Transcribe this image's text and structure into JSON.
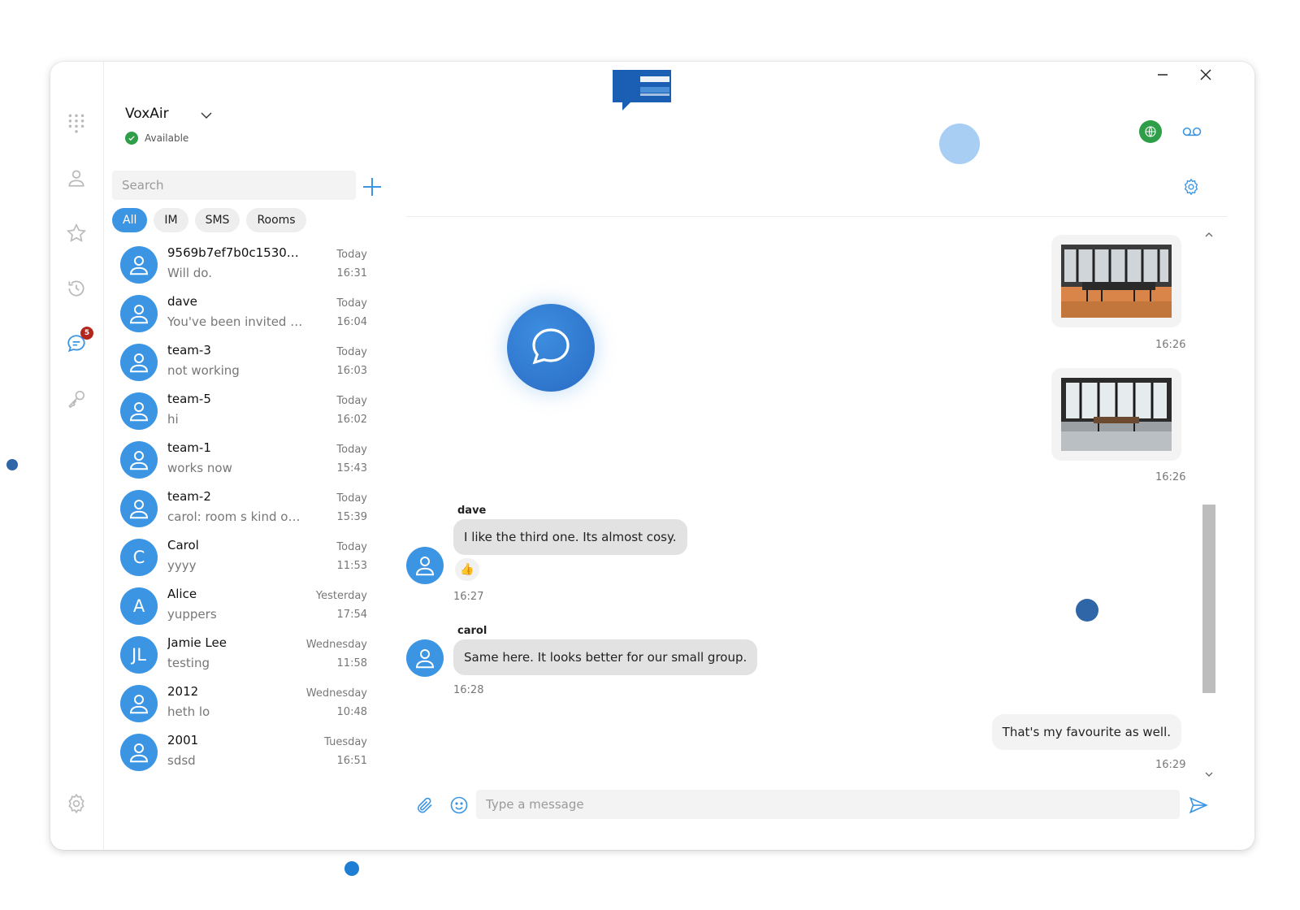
{
  "window": {
    "minimize_label": "—",
    "close_label": "✕"
  },
  "nav": {
    "items": [
      {
        "name": "dialpad"
      },
      {
        "name": "contacts"
      },
      {
        "name": "favorites"
      },
      {
        "name": "history"
      },
      {
        "name": "chat",
        "badge": "5"
      },
      {
        "name": "keys"
      },
      {
        "name": "settings"
      }
    ]
  },
  "account": {
    "name": "VoxAir",
    "status": "Available"
  },
  "search": {
    "placeholder": "Search"
  },
  "filters": [
    "All",
    "IM",
    "SMS",
    "Rooms"
  ],
  "conversations": [
    {
      "name": "9569b7ef7b0c15304...",
      "preview": "Will do.",
      "day": "Today",
      "time": "16:31",
      "avatar": ""
    },
    {
      "name": "dave",
      "preview": "You've been invited t...",
      "day": "Today",
      "time": "16:04",
      "avatar": ""
    },
    {
      "name": "team-3",
      "preview": "not working",
      "day": "Today",
      "time": "16:03",
      "avatar": ""
    },
    {
      "name": "team-5",
      "preview": "hi",
      "day": "Today",
      "time": "16:02",
      "avatar": ""
    },
    {
      "name": "team-1",
      "preview": "works now",
      "day": "Today",
      "time": "15:43",
      "avatar": ""
    },
    {
      "name": "team-2",
      "preview": "carol: room s kind of ...",
      "day": "Today",
      "time": "15:39",
      "avatar": ""
    },
    {
      "name": "Carol",
      "preview": "yyyy",
      "day": "Today",
      "time": "11:53",
      "avatar": "C"
    },
    {
      "name": "Alice",
      "preview": "yuppers",
      "day": "Yesterday",
      "time": "17:54",
      "avatar": "A"
    },
    {
      "name": "Jamie Lee",
      "preview": "testing",
      "day": "Wednesday",
      "time": "11:58",
      "avatar": "JL"
    },
    {
      "name": "2012",
      "preview": "heth lo",
      "day": "Wednesday",
      "time": "10:48",
      "avatar": ""
    },
    {
      "name": "2001",
      "preview": "sdsd",
      "day": "Tuesday",
      "time": "16:51",
      "avatar": ""
    }
  ],
  "messages": {
    "photo1_time": "16:26",
    "photo2_time": "16:26",
    "dave_sender": "dave",
    "dave_text": "I like the third one. Its almost cosy.",
    "dave_reaction": "👍",
    "dave_time": "16:27",
    "carol_sender": "carol",
    "carol_text": "Same here. It looks better for our small group.",
    "carol_time": "16:28",
    "own_text": "That's my favourite as well.",
    "own_time": "16:29"
  },
  "composer": {
    "placeholder": "Type a message"
  },
  "colors": {
    "accent": "#3b95e3",
    "logo": "#1a5fb4",
    "status_green": "#2e9e48",
    "badge": "#b3261e"
  }
}
